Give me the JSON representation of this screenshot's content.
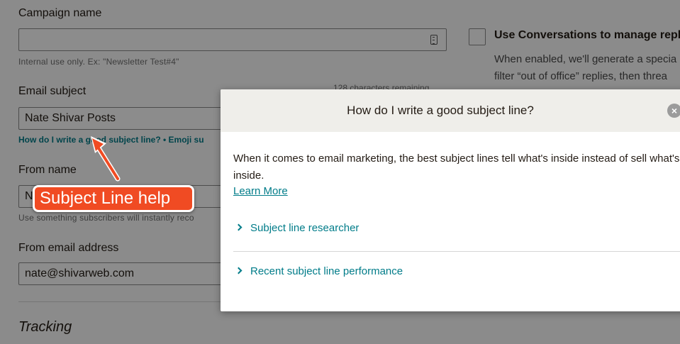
{
  "form": {
    "campaign_name_label": "Campaign name",
    "campaign_name_value": "",
    "campaign_name_hint": "Internal use only. Ex: \"Newsletter Test#4\"",
    "email_subject_label": "Email subject",
    "email_subject_value": "Nate Shivar Posts",
    "email_subject_help": "How do I write a good subject line? • Emoji su",
    "chars_left": "128 characters remaining",
    "from_name_label": "From name",
    "from_name_value": "N",
    "from_name_hint": "Use something subscribers will instantly reco",
    "from_email_label": "From email address",
    "from_email_value": "nate@shivarweb.com",
    "tracking_heading": "Tracking"
  },
  "conversations": {
    "label": "Use Conversations to manage replie",
    "description_lines": [
      "When enabled, we'll generate a specia",
      "filter “out of office” replies, then threa"
    ]
  },
  "modal": {
    "title": "How do I write a good subject line?",
    "close_icon": "×",
    "body": "When it comes to email marketing, the best subject lines tell what's inside instead of sell what's inside.",
    "learn_more": "Learn More",
    "accordion": [
      {
        "label": "Subject line researcher"
      },
      {
        "label": "Recent subject line performance"
      }
    ]
  },
  "annotation": {
    "callout_text": "Subject Line help",
    "accent_color": "#f04b23"
  },
  "colors": {
    "link": "#007c89",
    "overlay": "rgba(0,0,0,0.45)",
    "header_bg": "#efeeea"
  }
}
